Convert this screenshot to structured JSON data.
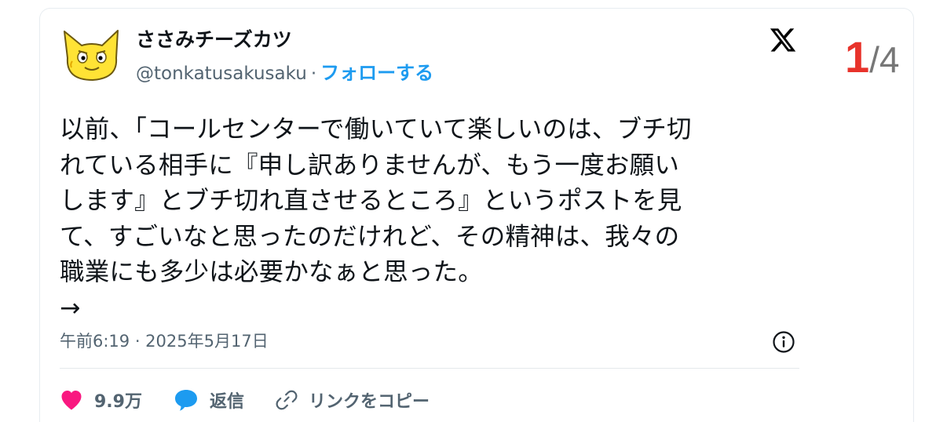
{
  "author": {
    "display_name": "ささみチーズカツ",
    "handle": "@tonkatusakusaku",
    "separator": "·",
    "follow_label": "フォローする"
  },
  "page_counter": {
    "current": "1",
    "total": "/4"
  },
  "post": {
    "lines": [
      "以前、「コールセンターで働いていて楽しいのは、ブチ切",
      "れている相手に『申し訳ありませんが、もう一度お願い",
      "します』とブチ切れ直させるところ』というポストを見",
      "て、すごいなと思ったのだけれど、その精神は、我々の",
      "職業にも多少は必要かなぁと思った。",
      "→"
    ],
    "timestamp": "午前6:19 · 2025年5月17日"
  },
  "actions": {
    "like_count": "9.9万",
    "reply_label": "返信",
    "copy_link_label": "リンクをコピー"
  },
  "icons": {
    "logo": "x-logo-icon",
    "info": "info-icon",
    "like": "heart-icon",
    "reply": "speech-bubble-icon",
    "link": "link-icon"
  },
  "colors": {
    "follow": "#1d9bf0",
    "like": "#f91880",
    "reply": "#1d9bf0",
    "counter_current": "#e8332b",
    "counter_total": "#777777",
    "text": "#0f1419",
    "muted": "#536471"
  }
}
